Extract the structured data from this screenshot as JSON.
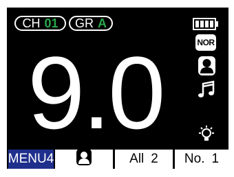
{
  "status": {
    "channel": {
      "label": "CH",
      "value": "01",
      "value_color": "#2aa84a"
    },
    "group": {
      "label": "GR",
      "value": "A",
      "value_color": "#2aa84a"
    }
  },
  "display": {
    "main_value": "9.0"
  },
  "indicators": {
    "battery": {
      "icon": "battery-full-icon",
      "level": 1.0
    },
    "mode_badge": "NOR",
    "person": {
      "icon": "person-icon"
    },
    "sound": {
      "icon": "music-note-icon"
    },
    "brightness": {
      "icon": "brightness-icon"
    }
  },
  "bottom_bar": {
    "menu_label": "MENU4",
    "menu_color": "#1f2f8c",
    "mode_icon": "person-icon",
    "all_label": "All",
    "all_value": "2",
    "no_label": "No.",
    "no_value": "1"
  }
}
